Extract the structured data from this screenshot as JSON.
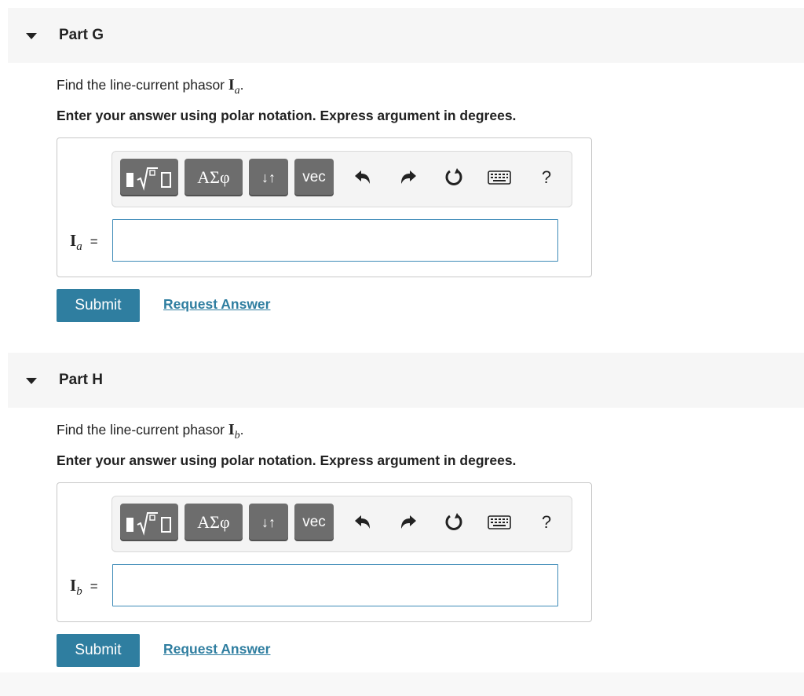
{
  "parts": [
    {
      "title": "Part G",
      "prompt_prefix": "Find the line-current phasor ",
      "phasor_symbol": "I",
      "phasor_sub": "a",
      "prompt_suffix": ".",
      "instruction": "Enter your answer using polar notation. Express argument in degrees.",
      "toolbar": {
        "templates_icon": "fraction-root-templates-icon",
        "greek_label": "ΑΣφ",
        "subsup_label": "↓↑",
        "vec_label": "vec",
        "help_label": "?"
      },
      "var_symbol": "I",
      "var_sub": "a",
      "equals": "=",
      "input_value": "",
      "submit_label": "Submit",
      "request_label": "Request Answer"
    },
    {
      "title": "Part H",
      "prompt_prefix": "Find the line-current phasor ",
      "phasor_symbol": "I",
      "phasor_sub": "b",
      "prompt_suffix": ".",
      "instruction": "Enter your answer using polar notation. Express argument in degrees.",
      "toolbar": {
        "templates_icon": "fraction-root-templates-icon",
        "greek_label": "ΑΣφ",
        "subsup_label": "↓↑",
        "vec_label": "vec",
        "help_label": "?"
      },
      "var_symbol": "I",
      "var_sub": "b",
      "equals": "=",
      "input_value": "",
      "submit_label": "Submit",
      "request_label": "Request Answer"
    }
  ],
  "colors": {
    "accent": "#2f7ea0",
    "toolbar_button": "#6d6d6d",
    "input_border": "#3e8bb8"
  },
  "icons": [
    "caret-down-icon",
    "undo-icon",
    "redo-icon",
    "reset-icon",
    "keyboard-icon"
  ]
}
